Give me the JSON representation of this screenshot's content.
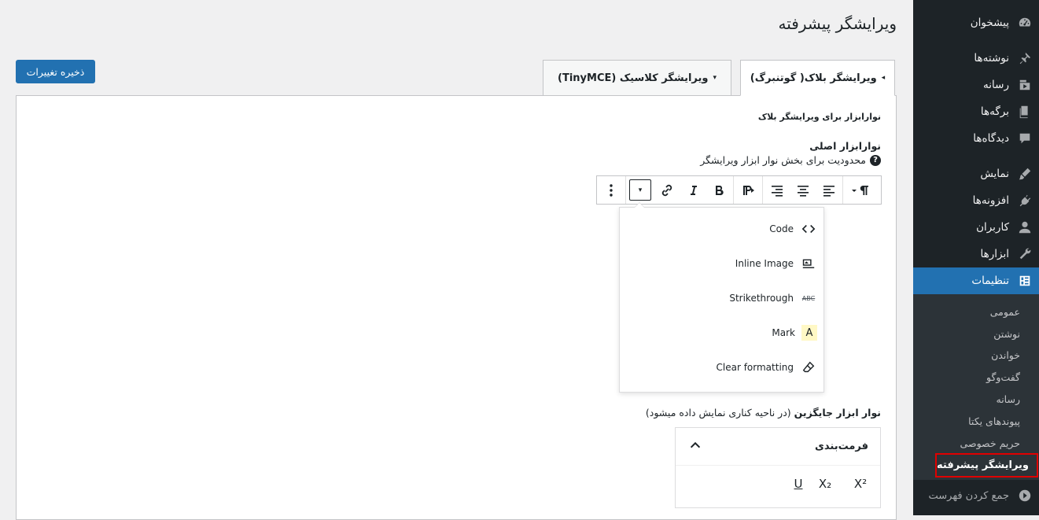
{
  "page": {
    "title": "ویرایشگر پیشرفته"
  },
  "sidebar": {
    "items": [
      {
        "label": "پیشخوان",
        "icon": "dashboard-icon"
      },
      {
        "label": "نوشته‌ها",
        "icon": "pin-icon"
      },
      {
        "label": "رسانه",
        "icon": "media-icon"
      },
      {
        "label": "برگه‌ها",
        "icon": "pages-icon"
      },
      {
        "label": "دیدگاه‌ها",
        "icon": "comments-icon"
      },
      {
        "label": "نمایش",
        "icon": "appearance-icon"
      },
      {
        "label": "افزونه‌ها",
        "icon": "plugins-icon"
      },
      {
        "label": "کاربران",
        "icon": "users-icon"
      },
      {
        "label": "ابزارها",
        "icon": "tools-icon"
      },
      {
        "label": "تنظیمات",
        "icon": "settings-icon",
        "active": true
      }
    ],
    "submenu": [
      {
        "label": "عمومی"
      },
      {
        "label": "نوشتن"
      },
      {
        "label": "خواندن"
      },
      {
        "label": "گفت‌وگو"
      },
      {
        "label": "رسانه"
      },
      {
        "label": "پیوندهای یکتا"
      },
      {
        "label": "حریم خصوصی"
      },
      {
        "label": "ویرایشگر پیشرفته",
        "current": true
      }
    ],
    "collapse_label": "جمع کردن فهرست",
    "active_color": "#2271b1",
    "highlight_border_color": "#e00000"
  },
  "actions": {
    "save_label": "ذخیره تغییرات"
  },
  "tabs": [
    {
      "label": "ویرایشگر بلاک( گوتنبرگ)",
      "active": true,
      "arrow": "◂"
    },
    {
      "label": "ویرایشگر کلاسیک (TinyMCE)",
      "active": false,
      "arrow": "▾"
    }
  ],
  "settings": {
    "section_heading": "نوارابزار برای ویرایشگر بلاک",
    "main_toolbar_label": "نوارابزار اصلی",
    "restriction_text": "محدودیت برای بخش نوار ابزار ویرایشگر",
    "help_glyph": "?",
    "floating_toolbar_label": "نوار ابزار جایگزین",
    "floating_toolbar_note": "(در ناحیه کناری نمایش داده میشود)"
  },
  "toolbar": {
    "dropdown_glyph": "▾",
    "buttons": [
      "paragraph",
      "align-left",
      "align-center",
      "align-right",
      "paragraph-rtl",
      "bold",
      "italic",
      "link",
      "more-dropdown",
      "options"
    ]
  },
  "dropdown": {
    "items": [
      {
        "label": "Code",
        "icon": "code-icon"
      },
      {
        "label": "Inline Image",
        "icon": "inline-image-icon"
      },
      {
        "label": "Strikethrough",
        "icon": "strikethrough-icon",
        "glyph": "ABC"
      },
      {
        "label": "Mark",
        "icon": "mark-icon",
        "glyph": "A"
      },
      {
        "label": "Clear formatting",
        "icon": "clear-formatting-icon"
      }
    ]
  },
  "format_panel": {
    "title": "فرمت‌بندی",
    "buttons": [
      {
        "name": "superscript",
        "glyph": "X²"
      },
      {
        "name": "subscript",
        "glyph": "X₂"
      },
      {
        "name": "underline",
        "glyph": "U"
      }
    ]
  }
}
